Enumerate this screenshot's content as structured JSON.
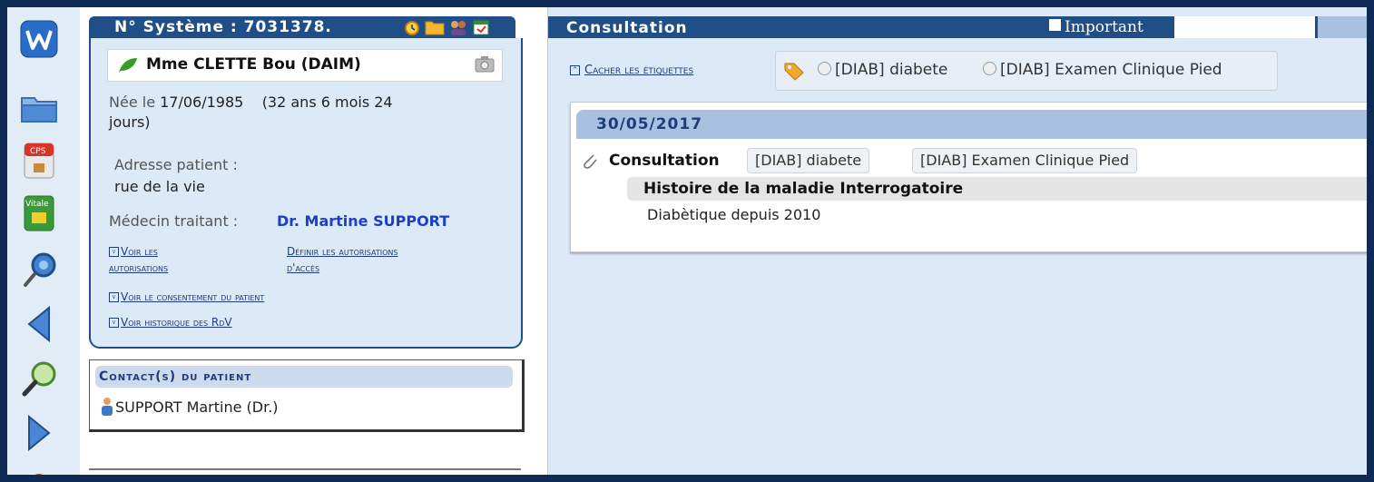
{
  "patient": {
    "system_title": "N° Système : 7031378.",
    "name": "Mme CLETTE Bou (DAIM)",
    "born_label": "Née le",
    "born_value": "17/06/1985",
    "age": "(32 ans 6 mois 24",
    "age_cont": "jours)",
    "address_label": "Adresse patient :",
    "address_value": "rue de la vie",
    "doctor_label": "Médecin traitant :",
    "doctor_value": "Dr. Martine SUPPORT",
    "links": {
      "view_auth_1": "Voir les",
      "view_auth_2": "autorisations",
      "define_auth_1": "Définir les autorisations",
      "define_auth_2": "d'accès",
      "consent": "Voir le consentement du patient",
      "history": "Voir historique des RdV"
    }
  },
  "contacts": {
    "title": "Contact(s) du patient",
    "item": "SUPPORT Martine (Dr.)"
  },
  "consultation": {
    "title": "Consultation",
    "important_label": "Important",
    "hide_tags": "Cacher les étiquettes",
    "tags": [
      "[DIAB] diabete",
      "[DIAB] Examen Clinique Pied"
    ],
    "entry": {
      "date": "30/05/2017",
      "label": "Consultation",
      "chips": [
        "[DIAB] diabete",
        "[DIAB] Examen Clinique Pied"
      ],
      "section_title": "Histoire de la maladie Interrogatoire",
      "section_text": "Diabètique depuis 2010"
    }
  },
  "icons": [
    "app-logo-icon",
    "folder-icon",
    "cps-card-icon",
    "vitale-card-icon",
    "stethoscope-icon",
    "back-arrow-icon",
    "magnifier-icon",
    "forward-arrow-icon",
    "user-icon",
    "alarm-icon",
    "folder-small-icon",
    "people-icon",
    "calendar-icon",
    "leaf-icon",
    "camera-icon",
    "tag-icon",
    "paperclip-icon",
    "contact-person-icon"
  ],
  "colors": {
    "header_blue": "#1f4f86",
    "panel_blue": "#dce9f7",
    "link_blue": "#1f3c7a",
    "doctor_blue": "#1e3fbf",
    "frame_dark": "#0f2a54"
  }
}
